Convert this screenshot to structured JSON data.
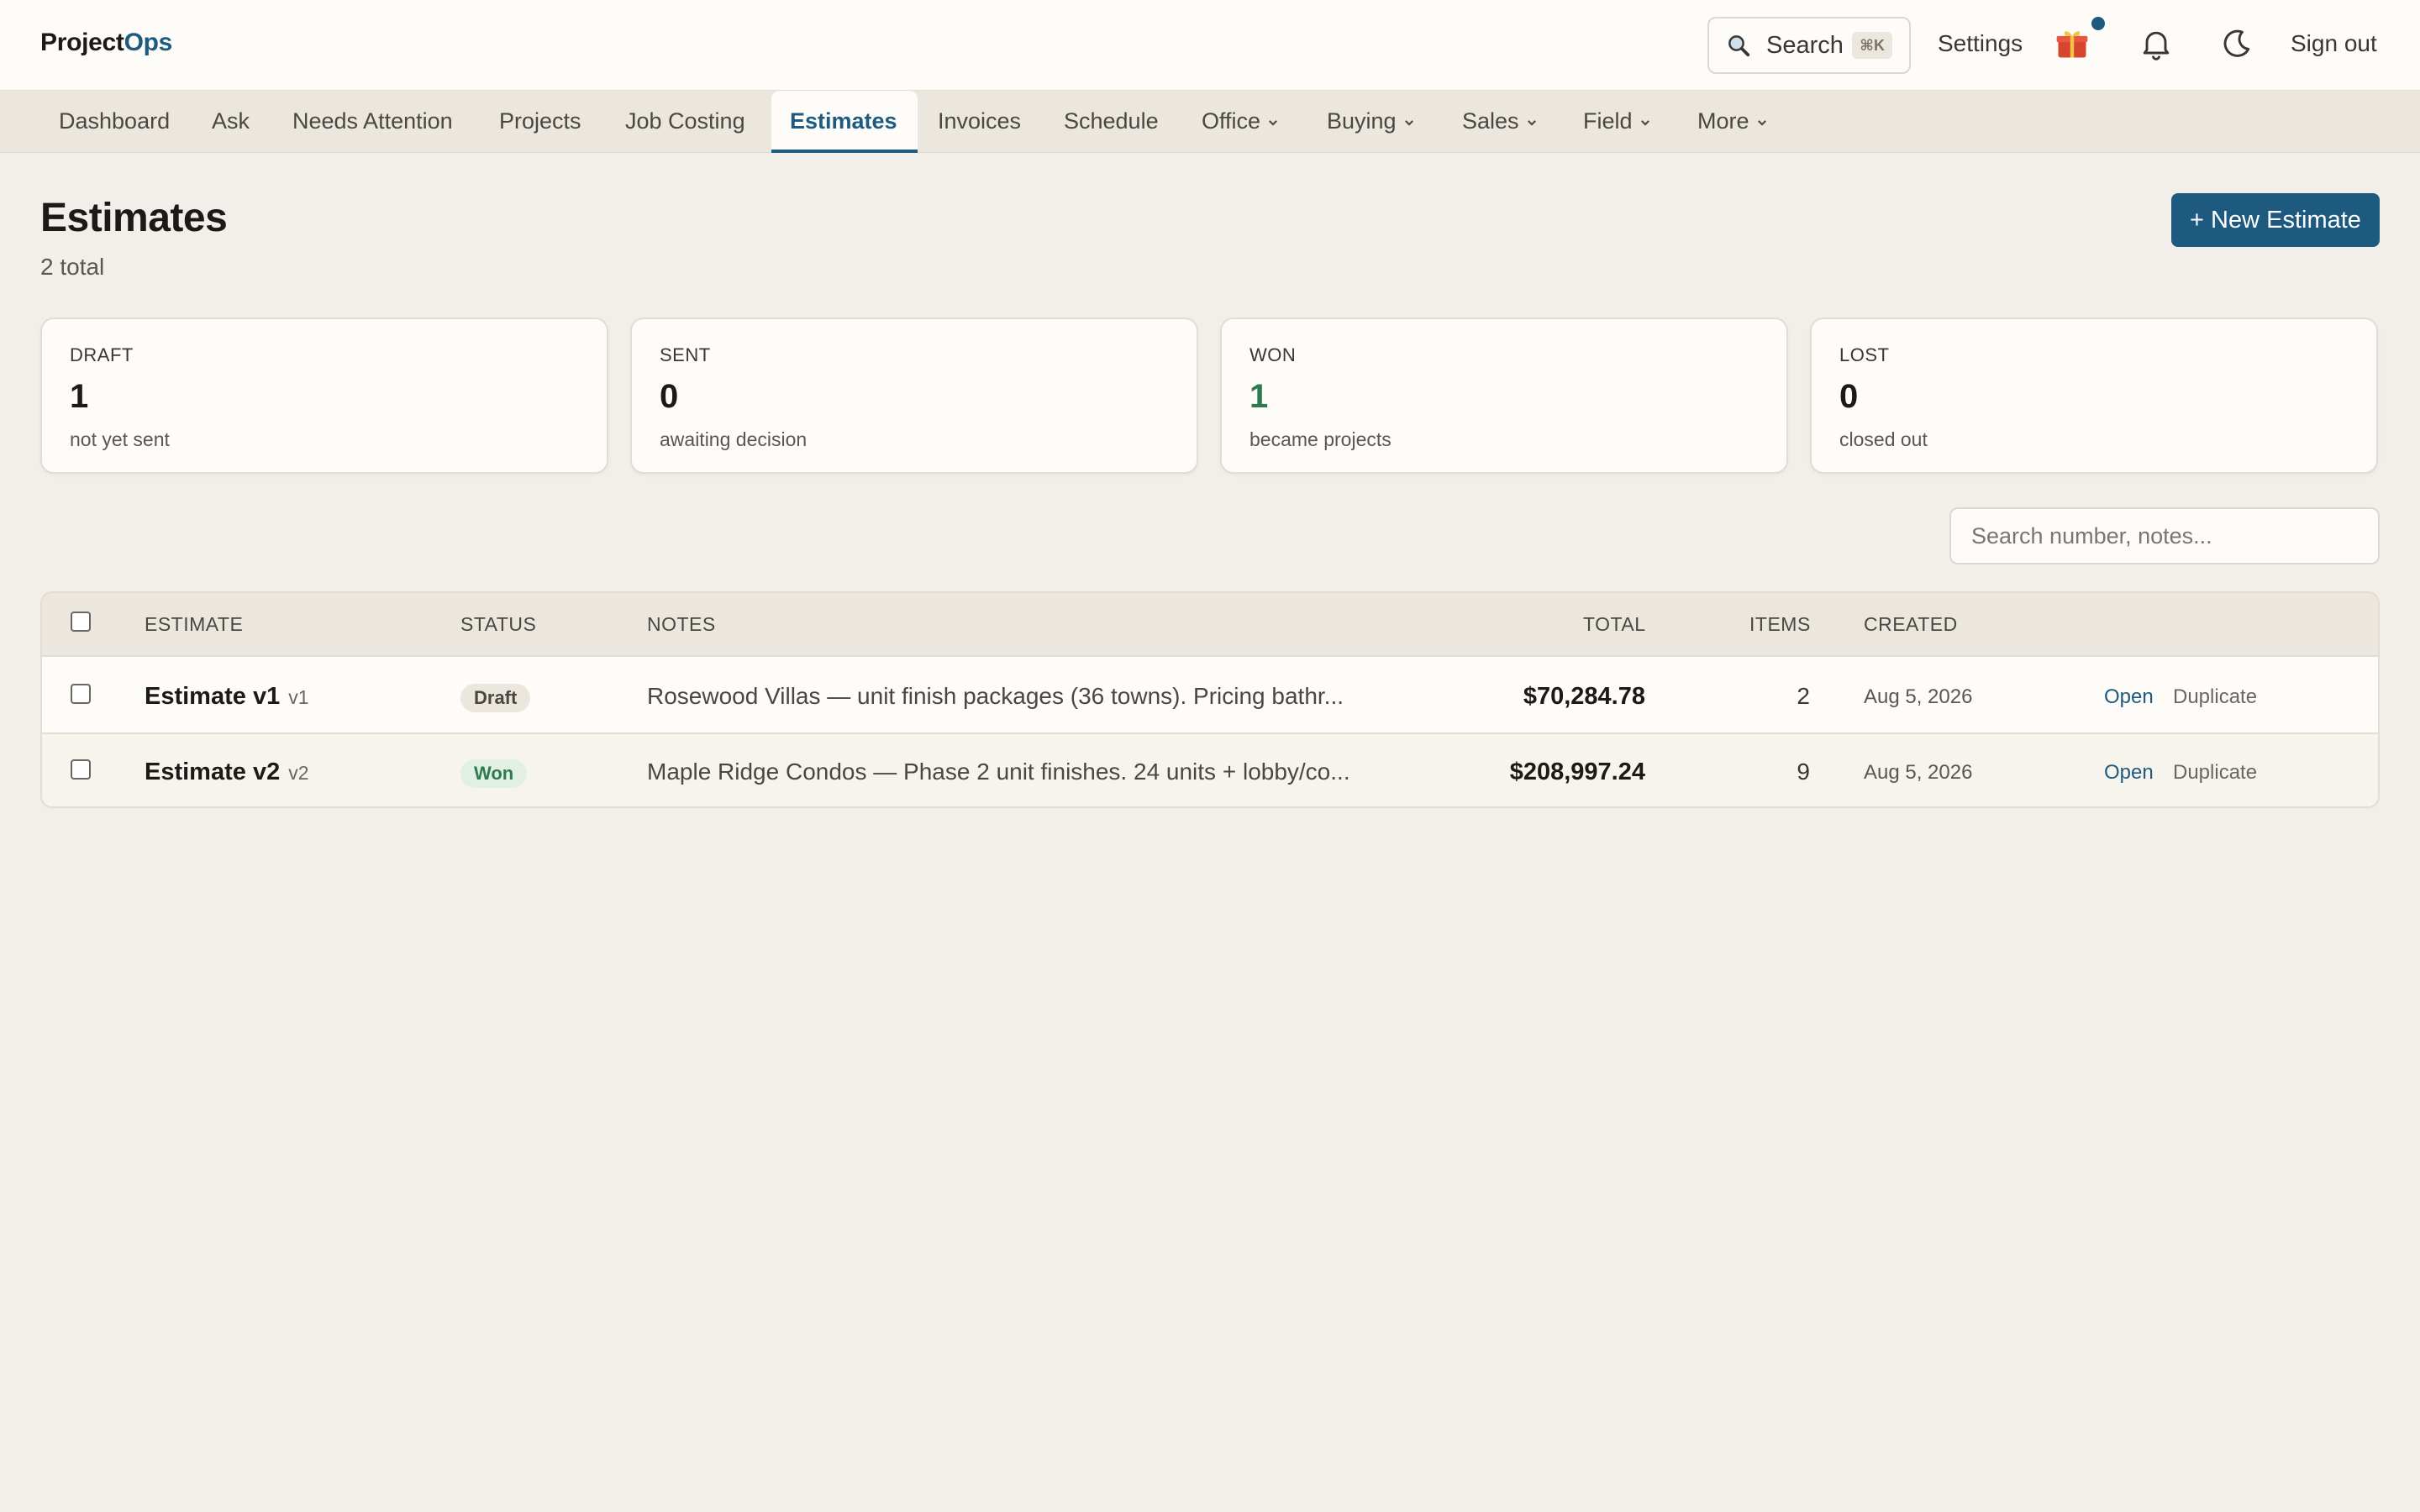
{
  "header": {
    "brand_part1": "Project",
    "brand_part2": "Ops",
    "search_label": "Search",
    "search_shortcut": "⌘K",
    "settings_label": "Settings",
    "signout_label": "Sign out",
    "icons": [
      "search-icon",
      "gift-icon",
      "bell-icon",
      "moon-icon"
    ],
    "accent_color": "#1e5a80"
  },
  "nav": {
    "items": [
      {
        "label": "Dashboard"
      },
      {
        "label": "Ask"
      },
      {
        "label": "Needs Attention"
      },
      {
        "label": "Projects"
      },
      {
        "label": "Job Costing"
      },
      {
        "label": "Estimates"
      },
      {
        "label": "Invoices"
      },
      {
        "label": "Schedule"
      },
      {
        "label": "Office"
      },
      {
        "label": "Buying"
      },
      {
        "label": "Sales"
      },
      {
        "label": "Field"
      },
      {
        "label": "More"
      }
    ],
    "active": "Estimates"
  },
  "page": {
    "title": "Estimates",
    "subtitle": "2 total",
    "new_button": "+ New Estimate"
  },
  "stats": [
    {
      "key": "DRAFT",
      "value": "1",
      "desc": "not yet sent"
    },
    {
      "key": "SENT",
      "value": "0",
      "desc": "awaiting decision"
    },
    {
      "key": "WON",
      "value": "1",
      "desc": "became projects",
      "color": "#2f7a4f"
    },
    {
      "key": "LOST",
      "value": "0",
      "desc": "closed out"
    }
  ],
  "filter": {
    "placeholder": "Search number, notes...",
    "value": ""
  },
  "table": {
    "columns": [
      "ESTIMATE",
      "STATUS",
      "NOTES",
      "TOTAL",
      "ITEMS",
      "CREATED"
    ],
    "rows": [
      {
        "name": "Estimate v1",
        "version": "v1",
        "status": "Draft",
        "notes": "Rosewood Villas — unit finish packages (36 towns). Pricing bathr...",
        "total": "$70,284.78",
        "items": "2",
        "created": "Aug 5, 2026",
        "open_label": "Open",
        "duplicate_label": "Duplicate"
      },
      {
        "name": "Estimate v2",
        "version": "v2",
        "status": "Won",
        "notes": "Maple Ridge Condos — Phase 2 unit finishes. 24 units + lobby/co...",
        "total": "$208,997.24",
        "items": "9",
        "created": "Aug 5, 2026",
        "open_label": "Open",
        "duplicate_label": "Duplicate"
      }
    ]
  }
}
